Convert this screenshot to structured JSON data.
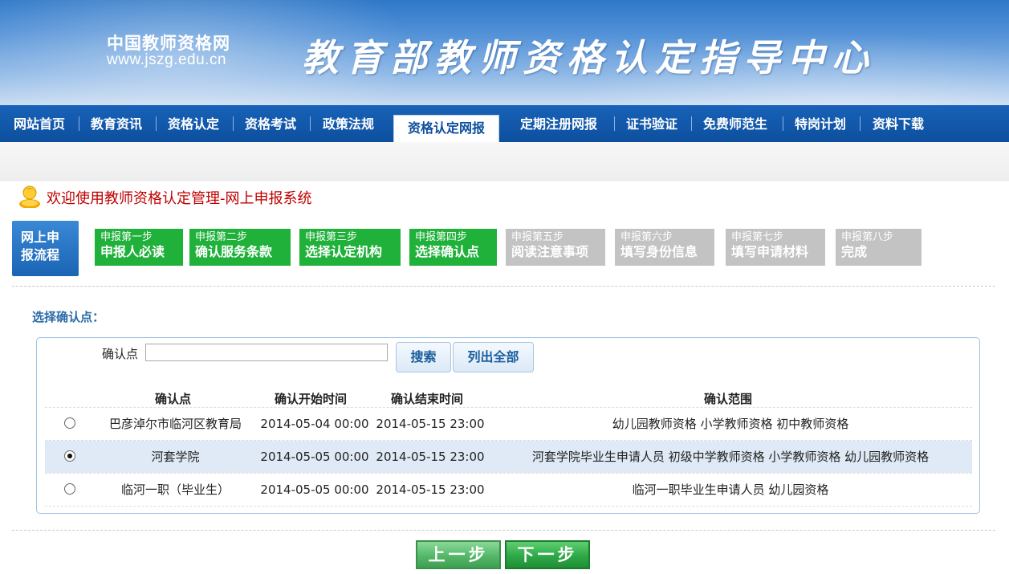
{
  "header": {
    "site_name": "中国教师资格网",
    "site_url": "www.jszg.edu.cn",
    "title": "教育部教师资格认定指导中心"
  },
  "nav": {
    "items": [
      "网站首页",
      "教育资讯",
      "资格认定",
      "资格考试",
      "政策法规",
      "资格认定网报",
      "定期注册网报",
      "证书验证",
      "免费师范生",
      "特岗计划",
      "资料下载"
    ],
    "active": "资格认定网报"
  },
  "welcome": {
    "text": "欢迎使用教师资格认定管理-网上申报系统",
    "icon": "user-icon"
  },
  "flow": {
    "label": "网上申报流程",
    "label_line1": "网上申",
    "label_line2": "报流程",
    "steps": [
      {
        "step": "申报第一步",
        "name": "申报人必读",
        "status": "done"
      },
      {
        "step": "申报第二步",
        "name": "确认服务条款",
        "status": "done"
      },
      {
        "step": "申报第三步",
        "name": "选择认定机构",
        "status": "done"
      },
      {
        "step": "申报第四步",
        "name": "选择确认点",
        "status": "done"
      },
      {
        "step": "申报第五步",
        "name": "阅读注意事项",
        "status": "todo"
      },
      {
        "step": "申报第六步",
        "name": "填写身份信息",
        "status": "todo"
      },
      {
        "step": "申报第七步",
        "name": "填写申请材料",
        "status": "todo"
      },
      {
        "step": "申报第八步",
        "name": "完成",
        "status": "todo"
      }
    ]
  },
  "section": {
    "title": "选择确认点：",
    "search_label": "确认点",
    "search_value": "",
    "search_button": "搜索",
    "list_all_button": "列出全部"
  },
  "table": {
    "headers": [
      "确认点",
      "确认开始时间",
      "确认结束时间",
      "确认范围"
    ],
    "rows": [
      {
        "selected": false,
        "point": "巴彦淖尔市临河区教育局",
        "start": "2014-05-04 00:00",
        "end": "2014-05-15 23:00",
        "scope": "幼儿园教师资格 小学教师资格 初中教师资格"
      },
      {
        "selected": true,
        "point": "河套学院",
        "start": "2014-05-05 00:00",
        "end": "2014-05-15 23:00",
        "scope": "河套学院毕业生申请人员 初级中学教师资格 小学教师资格 幼儿园教师资格"
      },
      {
        "selected": false,
        "point": "临河一职（毕业生）",
        "start": "2014-05-05 00:00",
        "end": "2014-05-15 23:00",
        "scope": "临河一职毕业生申请人员 幼儿园资格"
      }
    ]
  },
  "actions": {
    "prev": "上一步",
    "next": "下一步"
  },
  "colors": {
    "nav_bg": "#0d4f9e",
    "step_done": "#1fb13a",
    "step_todo": "#c3c3c3",
    "welcome_text": "#c00000",
    "selected_row": "#dfeaf6"
  }
}
